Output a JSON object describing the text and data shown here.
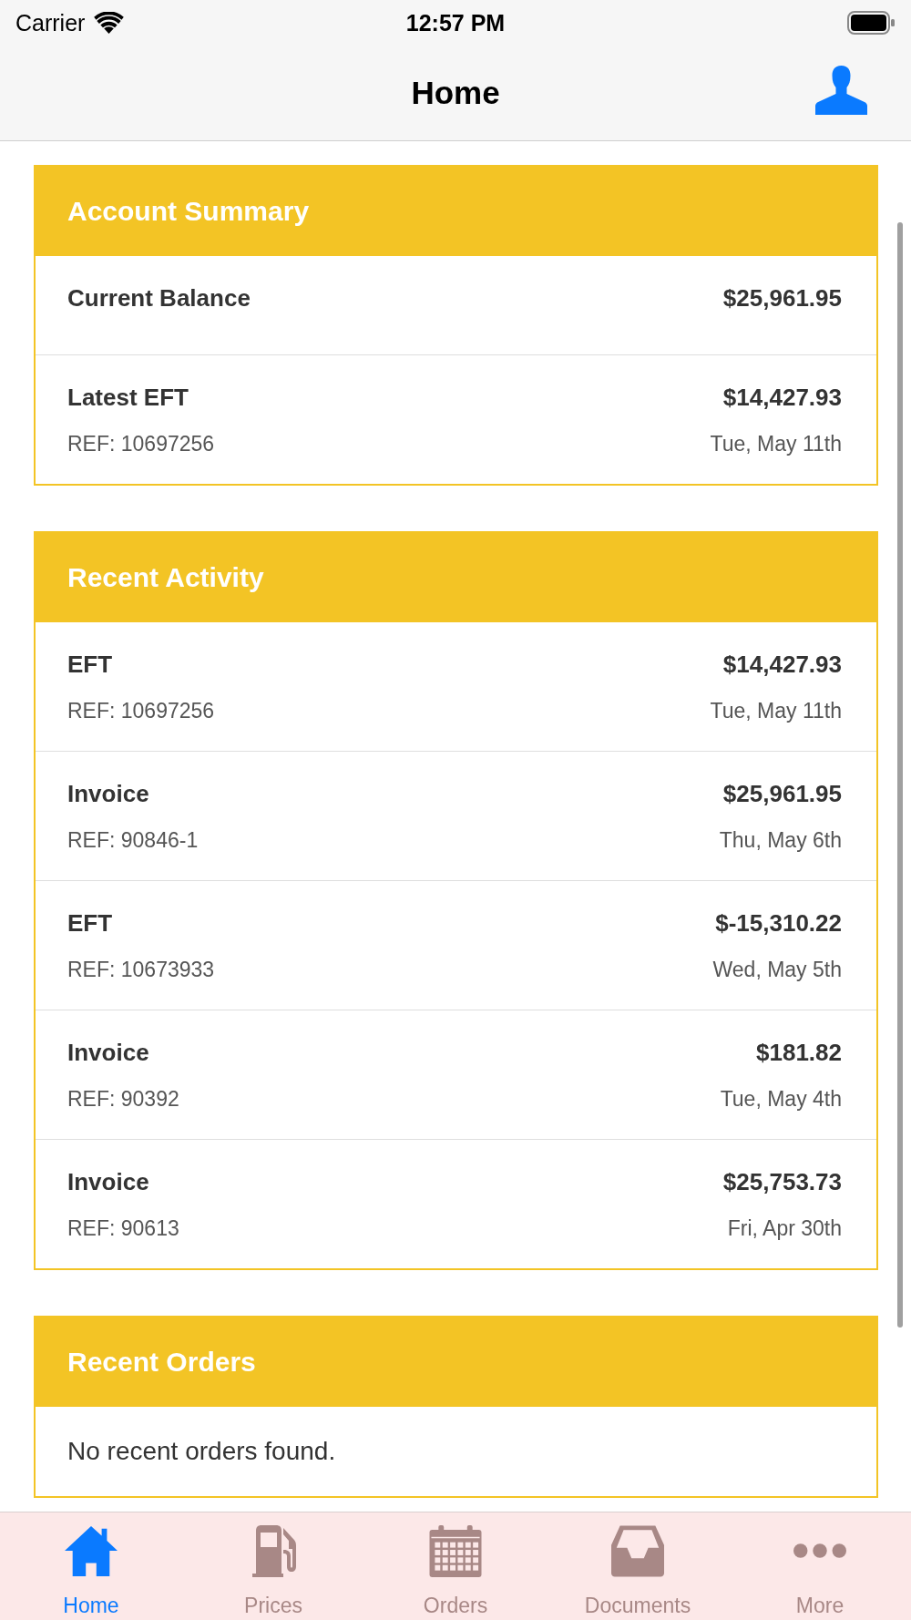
{
  "status_bar": {
    "carrier": "Carrier",
    "time": "12:57 PM"
  },
  "nav_bar": {
    "title": "Home"
  },
  "account_summary": {
    "title": "Account Summary",
    "rows": [
      {
        "label": "Current Balance",
        "amount": "$25,961.95"
      },
      {
        "label": "Latest EFT",
        "amount": "$14,427.93",
        "reference": "REF: 10697256",
        "date": "Tue, May 11th"
      }
    ]
  },
  "recent_activity": {
    "title": "Recent Activity",
    "rows": [
      {
        "label": "EFT",
        "amount": "$14,427.93",
        "reference": "REF: 10697256",
        "date": "Tue, May 11th"
      },
      {
        "label": "Invoice",
        "amount": "$25,961.95",
        "reference": "REF: 90846-1",
        "date": "Thu, May 6th"
      },
      {
        "label": "EFT",
        "amount": "$-15,310.22",
        "reference": "REF: 10673933",
        "date": "Wed, May 5th"
      },
      {
        "label": "Invoice",
        "amount": "$181.82",
        "reference": "REF: 90392",
        "date": "Tue, May 4th"
      },
      {
        "label": "Invoice",
        "amount": "$25,753.73",
        "reference": "REF: 90613",
        "date": "Fri, Apr 30th"
      }
    ]
  },
  "recent_orders": {
    "title": "Recent Orders",
    "empty_message": "No recent orders found."
  },
  "tab_bar": {
    "tabs": [
      {
        "label": "Home",
        "selected": true
      },
      {
        "label": "Prices",
        "selected": false
      },
      {
        "label": "Orders",
        "selected": false
      },
      {
        "label": "Documents",
        "selected": false
      },
      {
        "label": "More",
        "selected": false
      }
    ]
  }
}
